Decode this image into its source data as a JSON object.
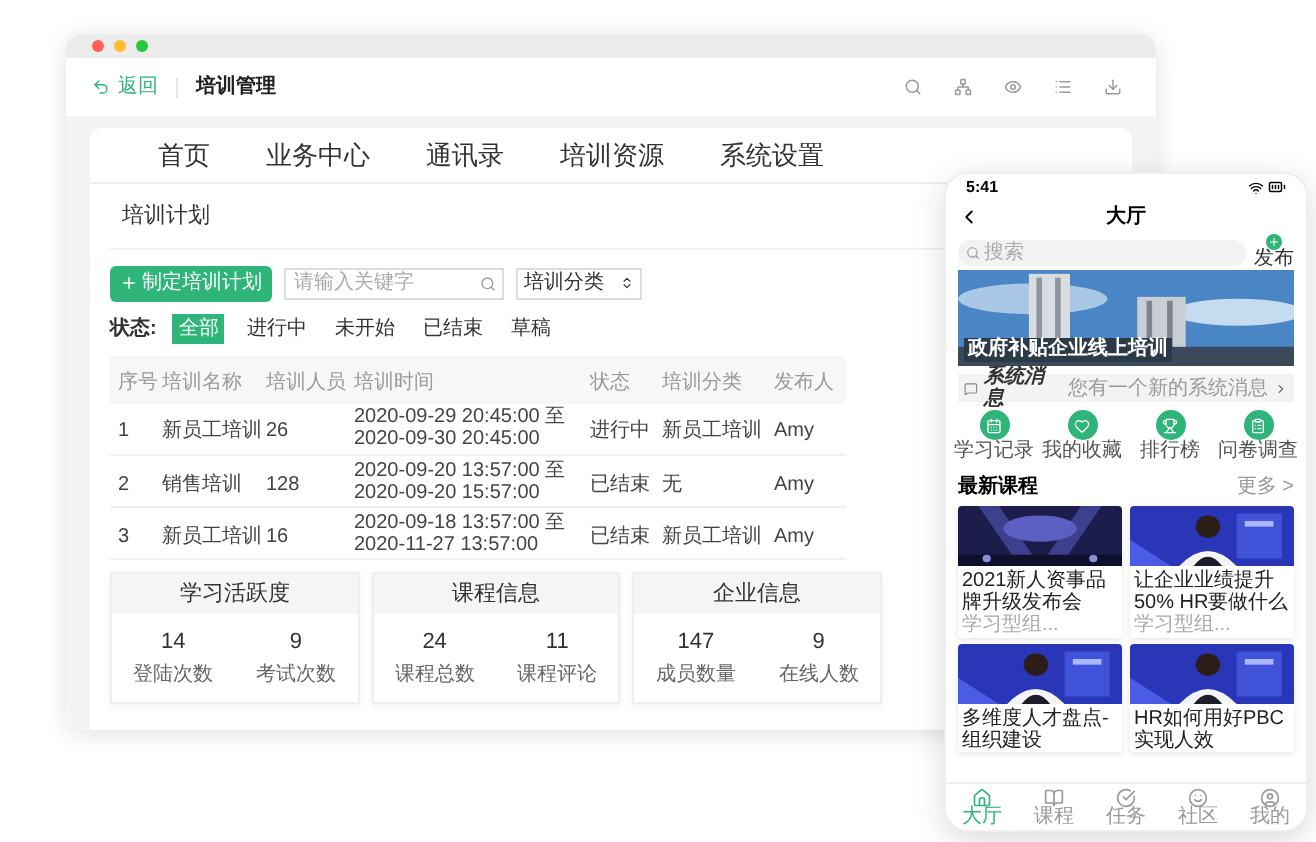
{
  "window": {
    "back": "返回",
    "title": "培训管理"
  },
  "nav_tabs": [
    "首页",
    "业务中心",
    "通讯录",
    "培训资源",
    "系统设置"
  ],
  "page_title": "培训计划",
  "toolbar": {
    "create_button": "制定培训计划",
    "search": {
      "placeholder": "请输入关键字"
    },
    "category_select": "培训分类"
  },
  "status_filter": {
    "label": "状态:",
    "options": [
      {
        "label": "全部",
        "selected": true
      },
      {
        "label": "进行中",
        "selected": false
      },
      {
        "label": "未开始",
        "selected": false
      },
      {
        "label": "已结束",
        "selected": false
      },
      {
        "label": "草稿",
        "selected": false
      }
    ]
  },
  "table": {
    "columns": [
      "序号",
      "培训名称",
      "培训人员",
      "培训时间",
      "状态",
      "培训分类",
      "发布人"
    ],
    "rows": [
      [
        "1",
        "新员工培训",
        "26",
        "2020-09-29 20:45:00 至 2020-09-30 20:45:00",
        "进行中",
        "新员工培训",
        "Amy"
      ],
      [
        "2",
        "销售培训",
        "128",
        "2020-09-20 13:57:00 至 2020-09-20 15:57:00",
        "已结束",
        "无",
        "Amy"
      ],
      [
        "3",
        "新员工培训",
        "16",
        "2020-09-18 13:57:00 至 2020-11-27 13:57:00",
        "已结束",
        "新员工培训",
        "Amy"
      ]
    ]
  },
  "stats": [
    {
      "title": "学习活跃度",
      "items": [
        {
          "value": "14",
          "label": "登陆次数"
        },
        {
          "value": "9",
          "label": "考试次数"
        }
      ]
    },
    {
      "title": "课程信息",
      "items": [
        {
          "value": "24",
          "label": "课程总数"
        },
        {
          "value": "11",
          "label": "课程评论"
        }
      ]
    },
    {
      "title": "企业信息",
      "items": [
        {
          "value": "147",
          "label": "成员数量"
        },
        {
          "value": "9",
          "label": "在线人数"
        }
      ]
    }
  ],
  "phone": {
    "time": "5:41",
    "title": "大厅",
    "search": {
      "placeholder": "搜索"
    },
    "publish": "发布",
    "banner": {
      "caption": "政府补贴企业线上培训"
    },
    "notice": {
      "title": "系统消息",
      "text": "您有一个新的系统消息"
    },
    "shortcuts": [
      {
        "kind": "calendar",
        "label": "学习记录"
      },
      {
        "kind": "heart",
        "label": "我的收藏"
      },
      {
        "kind": "trophy",
        "label": "排行榜"
      },
      {
        "kind": "survey",
        "label": "问卷调查"
      }
    ],
    "section": {
      "title": "最新课程",
      "more": "更多 >"
    },
    "courses": [
      {
        "kind": "stage",
        "title": "2021新人资事品牌升级发布会",
        "subtitle": "学习型组..."
      },
      {
        "kind": "speaker",
        "title": "让企业业绩提升50% HR要做什么",
        "subtitle": "学习型组..."
      },
      {
        "kind": "speaker",
        "title": "多维度人才盘点-组织建设"
      },
      {
        "kind": "speaker",
        "title": "HR如何用好PBC实现人效"
      }
    ],
    "tab_bar": [
      {
        "kind": "home",
        "label": "大厅",
        "selected": true
      },
      {
        "kind": "course",
        "label": "课程",
        "selected": false
      },
      {
        "kind": "task",
        "label": "任务",
        "selected": false
      },
      {
        "kind": "community",
        "label": "社区",
        "selected": false
      },
      {
        "kind": "me",
        "label": "我的",
        "selected": false
      }
    ]
  }
}
